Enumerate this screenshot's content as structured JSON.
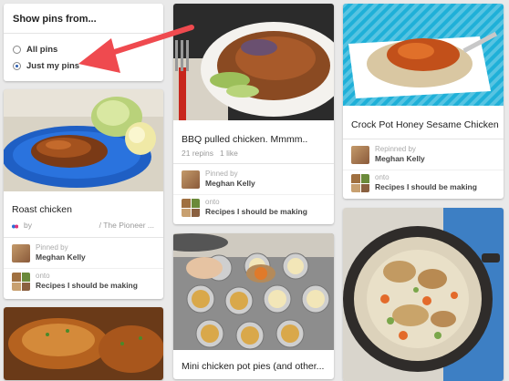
{
  "filter": {
    "title": "Show pins from...",
    "options": [
      {
        "label": "All pins",
        "selected": false
      },
      {
        "label": "Just my pins",
        "selected": true
      }
    ]
  },
  "pins": [
    {
      "title": "Roast chicken",
      "source_by": "by",
      "source_name": "/ The Pioneer ...",
      "pinned_label": "Pinned by",
      "pinned_name": "Meghan Kelly",
      "onto_label": "onto",
      "board": "Recipes I should be making"
    },
    {
      "title": "BBQ pulled chicken. Mmmm..",
      "stats": "21 repins   1 like",
      "pinned_label": "Pinned by",
      "pinned_name": "Meghan Kelly",
      "onto_label": "onto",
      "board": "Recipes I should be making"
    },
    {
      "title": "Mini chicken pot pies (and other..."
    },
    {
      "title": "Crock Pot Honey Sesame Chicken",
      "pinned_label": "Repinned by",
      "pinned_name": "Meghan Kelly",
      "onto_label": "onto",
      "board": "Recipes I should be making"
    }
  ],
  "colors": {
    "arrow": "#ef4a4f",
    "radio_selected": "#2a5db0",
    "bowl_bg": "#1fb0d8"
  }
}
